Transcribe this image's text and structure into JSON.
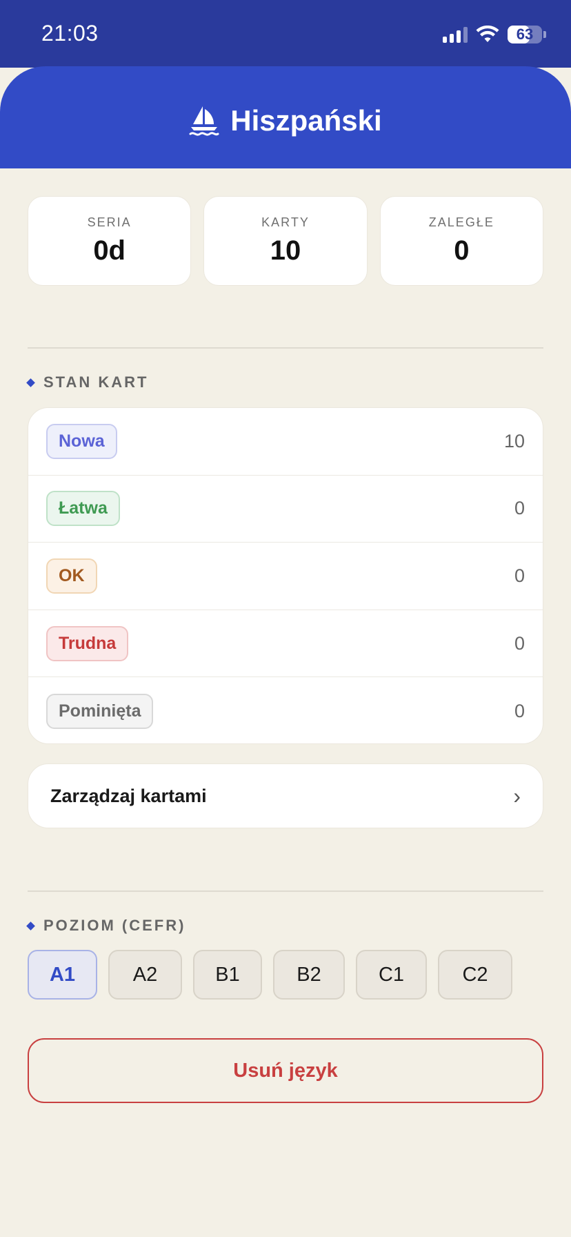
{
  "status_bar": {
    "time": "21:03",
    "battery": "63",
    "battery_level": 0.63,
    "icons": [
      "signal-icon",
      "wifi-icon",
      "battery-icon"
    ]
  },
  "header": {
    "title": "Hiszpański",
    "icon": "sailboat-icon",
    "color": "#324bc6"
  },
  "stats": [
    {
      "label": "SERIA",
      "value": "0d"
    },
    {
      "label": "KARTY",
      "value": "10"
    },
    {
      "label": "ZALEGŁE",
      "value": "0"
    }
  ],
  "card_state": {
    "title": "STAN KART",
    "items": [
      {
        "label": "Nowa",
        "count": "10",
        "color": "#5b63d6",
        "bg": "#eef0fb",
        "border": "#c8ccf0"
      },
      {
        "label": "Łatwa",
        "count": "0",
        "color": "#3f9a52",
        "bg": "#ebf6ee",
        "border": "#bfe2c8"
      },
      {
        "label": "OK",
        "count": "0",
        "color": "#a25a20",
        "bg": "#fcf1e5",
        "border": "#f1d6b4"
      },
      {
        "label": "Trudna",
        "count": "0",
        "color": "#c63a3a",
        "bg": "#fbe9e9",
        "border": "#f0c4c4"
      },
      {
        "label": "Pominięta",
        "count": "0",
        "color": "#6b6b6b",
        "bg": "#f4f4f4",
        "border": "#d8d8d8"
      }
    ]
  },
  "manage": {
    "label": "Zarządzaj kartami",
    "chevron": "›"
  },
  "level": {
    "title": "POZIOM (CEFR)",
    "options": [
      "A1",
      "A2",
      "B1",
      "B2",
      "C1",
      "C2"
    ],
    "selected": "A1"
  },
  "delete_button": {
    "label": "Usuń język",
    "color": "#c84040"
  }
}
